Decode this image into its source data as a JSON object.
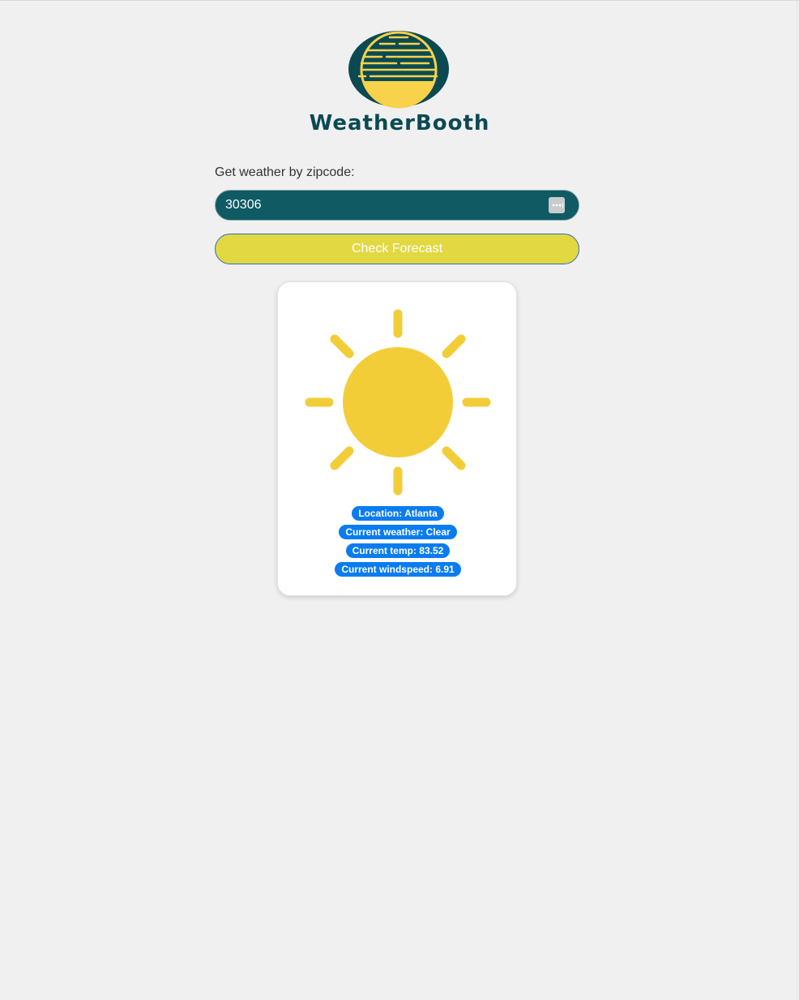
{
  "brand": {
    "name": "WeatherBooth"
  },
  "form": {
    "label": "Get weather by zipcode:",
    "zipcode_value": "30306",
    "submit_label": "Check Forecast"
  },
  "weather": {
    "icon": "sun-icon",
    "location": "Location: Atlanta",
    "condition": "Current weather: Clear",
    "temp": "Current temp: 83.52",
    "windspeed": "Current windspeed: 6.91"
  },
  "colors": {
    "background": "#f0f0f0",
    "brand_teal": "#0b4a52",
    "input_bg": "#0f5a63",
    "button_yellow": "#e2d842",
    "sun_yellow": "#f3cd38",
    "badge_blue": "#0a7cf0"
  }
}
